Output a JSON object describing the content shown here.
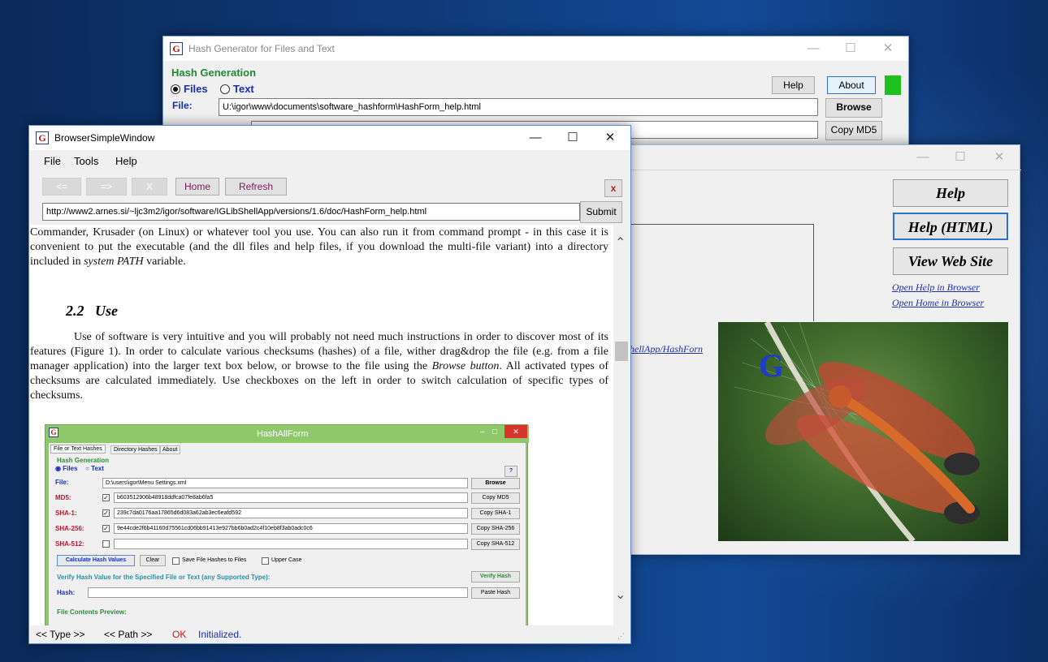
{
  "hash_window": {
    "title": "Hash Generator for Files and Text",
    "section_label": "Hash Generation",
    "radio_files": "Files",
    "radio_text": "Text",
    "help_button": "Help",
    "about_button": "About",
    "file_label": "File:",
    "file_path": "U:\\igor\\www\\documents\\software_hashform\\HashForm_help.html",
    "browse_button": "Browse",
    "copy_md5_button": "Copy MD5",
    "status_color": "#1fc11f"
  },
  "help_window": {
    "help_button": "Help",
    "help_html_button": "Help (HTML)",
    "view_web_site_button": "View Web Site",
    "open_help_link": "Open Help in Browser",
    "open_home_link": "Open Home in Browser",
    "partial_link": "hellApp/HashForn",
    "logo_glyph": "G"
  },
  "browser_window": {
    "title": "BrowserSimpleWindow",
    "menu": [
      "File",
      "Tools",
      "Help"
    ],
    "back_button": "<=",
    "forward_button": "=>",
    "stop_button": "X",
    "home_button": "Home",
    "refresh_button": "Refresh",
    "close_x_button": "x",
    "url": "http://www2.arnes.si/~ljc3m2/igor/software/IGLibShellApp/versions/1.6/doc/HashForm_help.html",
    "submit_button": "Submit",
    "status_type": "<< Type >>",
    "status_path": "<< Path >>",
    "status_ok": "OK",
    "status_message": "Initialized."
  },
  "document": {
    "paragraph1_pre": "Commander, Krusader (on Linux) or whatever tool you use. You can also run it from command prompt - in this case it is convenient to put the executable (and the dll files and help files, if you download the multi-file variant) into a directory included in ",
    "paragraph1_emph": "system PATH",
    "paragraph1_post": " variable.",
    "heading": "2.2   Use",
    "paragraph2_pre": "Use of software is very intuitive and you will probably not need much instructions in order to discover most of its features (Figure 1). In order to calculate various checksums (hashes) of a file, wither drag&drop the file (e.g. from a file manager application) into the larger text box below, or browse to the file using the ",
    "paragraph2_emph": "Browse button",
    "paragraph2_post": ". All activated types of checksums are calculated immediately. Use checkboxes on the left in order to switch calculation of specific types of checksums."
  },
  "figure": {
    "title": "HashAllForm",
    "tabs": [
      "File or Text Hashes",
      "Directory Hashes",
      "About"
    ],
    "section_label": "Hash Generation",
    "radio_files": "Files",
    "radio_text": "Text",
    "help_q": "?",
    "file_label": "File:",
    "file_value": "D:\\users\\igor\\Menu Settings.xml",
    "browse_button": "Browse",
    "rows": [
      {
        "label": "MD5:",
        "checked": true,
        "value": "b603512906b48918ddfca07fe8ab6fa5",
        "button": "Copy MD5"
      },
      {
        "label": "SHA-1:",
        "checked": true,
        "value": "239c7da0176aa17865d6d083a62ab3ec6eafd592",
        "button": "Copy SHA-1"
      },
      {
        "label": "SHA-256:",
        "checked": true,
        "value": "9e44cde2f6b41160d75561cd06bb91413e927bb6b0ad2c4f10eb8f3ab0adc0c6",
        "button": "Copy SHA-256"
      },
      {
        "label": "SHA-512:",
        "checked": false,
        "value": "",
        "button": "Copy SHA-512"
      }
    ],
    "calc_button": "Calculate Hash Values",
    "clear_button": "Clear",
    "save_check_label": "Save File Hashes to Files",
    "upper_case_label": "Upper Case",
    "verify_label": "Verify Hash Value for the Specified File or Text (any Supported Type):",
    "verify_button": "Verify Hash",
    "hash_label": "Hash:",
    "paste_button": "Paste Hash",
    "preview_label": "File Contents Preview:"
  }
}
